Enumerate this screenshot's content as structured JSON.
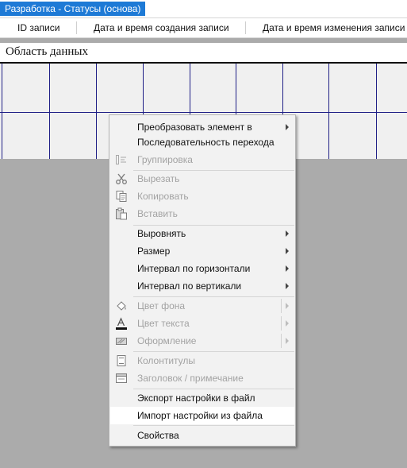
{
  "tab": {
    "title": "Разработка - Статусы (основа)"
  },
  "columns": [
    "ID записи",
    "Дата и время создания записи",
    "Дата и время изменения записи"
  ],
  "section": {
    "title": "Область данных"
  },
  "menu": {
    "items": [
      {
        "label": "Преобразовать элемент в",
        "enabled": true,
        "submenu": true
      },
      {
        "label": "Последовательность перехода",
        "enabled": true
      },
      {
        "label": "Группировка",
        "enabled": false,
        "icon": "grouping-icon"
      },
      {
        "label": "Вырезать",
        "enabled": false,
        "icon": "scissors-icon"
      },
      {
        "label": "Копировать",
        "enabled": false,
        "icon": "copy-icon"
      },
      {
        "label": "Вставить",
        "enabled": false,
        "icon": "paste-icon"
      },
      {
        "label": "Выровнять",
        "enabled": true,
        "submenu": true
      },
      {
        "label": "Размер",
        "enabled": true,
        "submenu": true
      },
      {
        "label": "Интервал по горизонтали",
        "enabled": true,
        "submenu": true
      },
      {
        "label": "Интервал по вертикали",
        "enabled": true,
        "submenu": true
      },
      {
        "label": "Цвет фона",
        "enabled": false,
        "icon": "fill-color-icon",
        "submenu": true
      },
      {
        "label": "Цвет текста",
        "enabled": false,
        "icon": "font-color-icon",
        "submenu": true
      },
      {
        "label": "Оформление",
        "enabled": false,
        "icon": "special-effect-icon",
        "submenu": true
      },
      {
        "label": "Колонтитулы",
        "enabled": false,
        "icon": "page-header-icon"
      },
      {
        "label": "Заголовок / примечание",
        "enabled": false,
        "icon": "form-header-icon"
      },
      {
        "label": "Экспорт настройки в файл",
        "enabled": true
      },
      {
        "label": "Импорт настройки из файла",
        "enabled": true,
        "highlighted": true
      },
      {
        "label": "Свойства",
        "enabled": true
      }
    ]
  },
  "colors": {
    "accent": "#1e7ad6",
    "grid_line": "#1f1f86",
    "background": "#ababab"
  }
}
